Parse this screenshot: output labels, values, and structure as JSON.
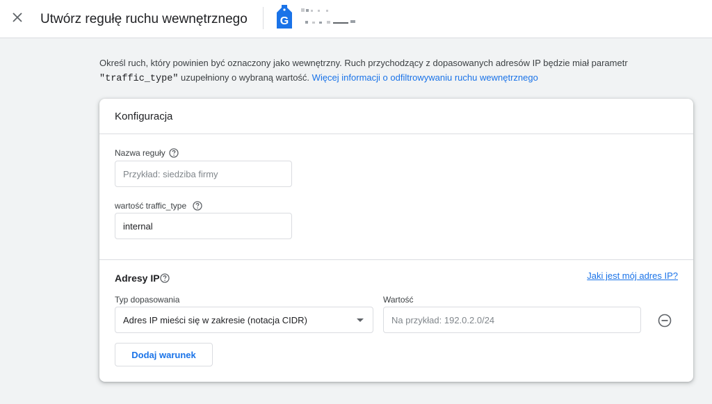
{
  "header": {
    "close_icon": "close-icon",
    "title": "Utwórz regułę ruchu wewnętrznego",
    "property_icon": "google-analytics-tag-icon",
    "property_icon_letter": "G"
  },
  "intro": {
    "text_before_code": "Określ ruch, który powinien być oznaczony jako wewnętrzny. Ruch przychodzący z dopasowanych adresów IP będzie miał parametr",
    "code": "\"traffic_type\"",
    "text_after_code": "uzupełniony o wybraną wartość.",
    "link": "Więcej informacji o odfiltrowywaniu ruchu wewnętrznego"
  },
  "config": {
    "title": "Konfiguracja",
    "rule_name": {
      "label": "Nazwa reguły",
      "placeholder": "Przykład: siedziba firmy",
      "value": ""
    },
    "traffic_type": {
      "label": "wartość traffic_type",
      "value": "internal"
    },
    "ip_addresses": {
      "title": "Adresy IP",
      "my_ip_link": "Jaki jest mój adres IP?",
      "match_type_label": "Typ dopasowania",
      "match_type_value": "Adres IP mieści się w zakresie (notacja CIDR)",
      "value_label": "Wartość",
      "value_placeholder": "Na przykład: 192.0.2.0/24",
      "add_condition": "Dodaj warunek"
    }
  },
  "colors": {
    "accent": "#1a73e8",
    "background": "#f1f3f4",
    "border": "#dadce0"
  }
}
